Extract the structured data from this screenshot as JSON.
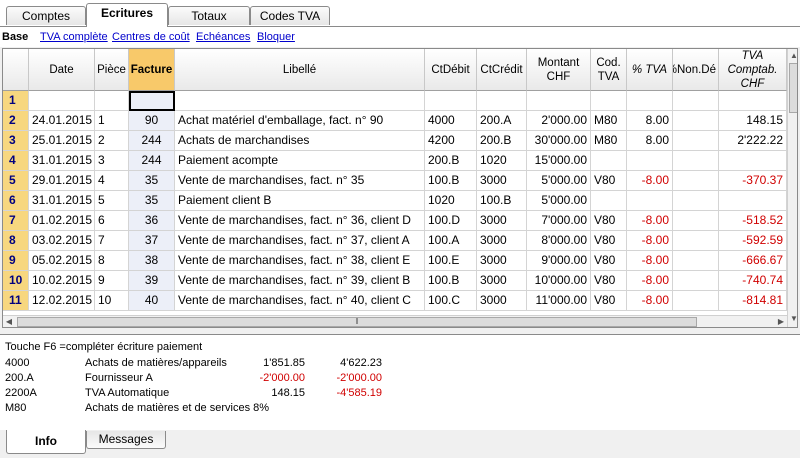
{
  "top_tabs": [
    "Comptes",
    "Ecritures",
    "Totaux",
    "Codes TVA"
  ],
  "active_top_tab": "Ecritures",
  "views": {
    "current": "Base",
    "links": [
      "TVA complète",
      "Centres de coût",
      "Echéances",
      "Bloquer"
    ]
  },
  "columns": [
    "Date",
    "Pièce",
    "Facture",
    "Libellé",
    "CtDébit",
    "CtCrédit",
    "Montant CHF",
    "Cod. TVA",
    "% TVA",
    "%Non.Dé",
    "TVA Comptab. CHF"
  ],
  "rows": [
    {
      "n": "1",
      "date": "",
      "piece": "",
      "facture": "",
      "libelle": "",
      "ctdebit": "",
      "ctcredit": "",
      "montant": "",
      "codtva": "",
      "pcttva": "",
      "nonded": "",
      "tvacompt": ""
    },
    {
      "n": "2",
      "date": "24.01.2015",
      "piece": "1",
      "facture": "90",
      "libelle": "Achat matériel d'emballage, fact. n° 90",
      "ctdebit": "4000",
      "ctcredit": "200.A",
      "montant": "2'000.00",
      "codtva": "M80",
      "pcttva": "8.00",
      "nonded": "",
      "tvacompt": "148.15"
    },
    {
      "n": "3",
      "date": "25.01.2015",
      "piece": "2",
      "facture": "244",
      "libelle": "Achats de marchandises",
      "ctdebit": "4200",
      "ctcredit": "200.B",
      "montant": "30'000.00",
      "codtva": "M80",
      "pcttva": "8.00",
      "nonded": "",
      "tvacompt": "2'222.22"
    },
    {
      "n": "4",
      "date": "31.01.2015",
      "piece": "3",
      "facture": "244",
      "libelle": "Paiement acompte",
      "ctdebit": "200.B",
      "ctcredit": "1020",
      "montant": "15'000.00",
      "codtva": "",
      "pcttva": "",
      "nonded": "",
      "tvacompt": ""
    },
    {
      "n": "5",
      "date": "29.01.2015",
      "piece": "4",
      "facture": "35",
      "libelle": "Vente de marchandises, fact. n° 35",
      "ctdebit": "100.B",
      "ctcredit": "3000",
      "montant": "5'000.00",
      "codtva": "V80",
      "pcttva": "-8.00",
      "nonded": "",
      "tvacompt": "-370.37"
    },
    {
      "n": "6",
      "date": "31.01.2015",
      "piece": "5",
      "facture": "35",
      "libelle": "Paiement client B",
      "ctdebit": "1020",
      "ctcredit": "100.B",
      "montant": "5'000.00",
      "codtva": "",
      "pcttva": "",
      "nonded": "",
      "tvacompt": ""
    },
    {
      "n": "7",
      "date": "01.02.2015",
      "piece": "6",
      "facture": "36",
      "libelle": "Vente de marchandises, fact. n° 36, client D",
      "ctdebit": "100.D",
      "ctcredit": "3000",
      "montant": "7'000.00",
      "codtva": "V80",
      "pcttva": "-8.00",
      "nonded": "",
      "tvacompt": "-518.52"
    },
    {
      "n": "8",
      "date": "03.02.2015",
      "piece": "7",
      "facture": "37",
      "libelle": "Vente de marchandises, fact. n° 37, client A",
      "ctdebit": "100.A",
      "ctcredit": "3000",
      "montant": "8'000.00",
      "codtva": "V80",
      "pcttva": "-8.00",
      "nonded": "",
      "tvacompt": "-592.59"
    },
    {
      "n": "9",
      "date": "05.02.2015",
      "piece": "8",
      "facture": "38",
      "libelle": "Vente de marchandises, fact. n° 38, client E",
      "ctdebit": "100.E",
      "ctcredit": "3000",
      "montant": "9'000.00",
      "codtva": "V80",
      "pcttva": "-8.00",
      "nonded": "",
      "tvacompt": "-666.67"
    },
    {
      "n": "10",
      "date": "10.02.2015",
      "piece": "9",
      "facture": "39",
      "libelle": "Vente de marchandises, fact. n° 39, client B",
      "ctdebit": "100.B",
      "ctcredit": "3000",
      "montant": "10'000.00",
      "codtva": "V80",
      "pcttva": "-8.00",
      "nonded": "",
      "tvacompt": "-740.74"
    },
    {
      "n": "11",
      "date": "12.02.2015",
      "piece": "10",
      "facture": "40",
      "libelle": "Vente de marchandises, fact. n° 40, client C",
      "ctdebit": "100.C",
      "ctcredit": "3000",
      "montant": "11'000.00",
      "codtva": "V80",
      "pcttva": "-8.00",
      "nonded": "",
      "tvacompt": "-814.81"
    }
  ],
  "info": {
    "hint": "Touche F6 =compléter écriture paiement",
    "lines": [
      {
        "account": "4000",
        "label": "Achats de matières/appareils",
        "amount": "1'851.85",
        "balance": "4'622.23"
      },
      {
        "account": "200.A",
        "label": "Fournisseur A",
        "amount": "-2'000.00",
        "balance": "-2'000.00"
      },
      {
        "account": "2200A",
        "label": "TVA Automatique",
        "amount": "148.15",
        "balance": "-4'585.19"
      },
      {
        "account": "M80",
        "label": "Achats de matières et de services 8%",
        "amount": "",
        "balance": ""
      }
    ]
  },
  "bottom_tabs": [
    "Info",
    "Messages"
  ],
  "active_bottom_tab": "Info",
  "colors": {
    "row_number_bg": "#f7d77f",
    "factura_header_bg": "#f8c96a",
    "negative_text": "#d00000",
    "link": "#0000cc"
  }
}
